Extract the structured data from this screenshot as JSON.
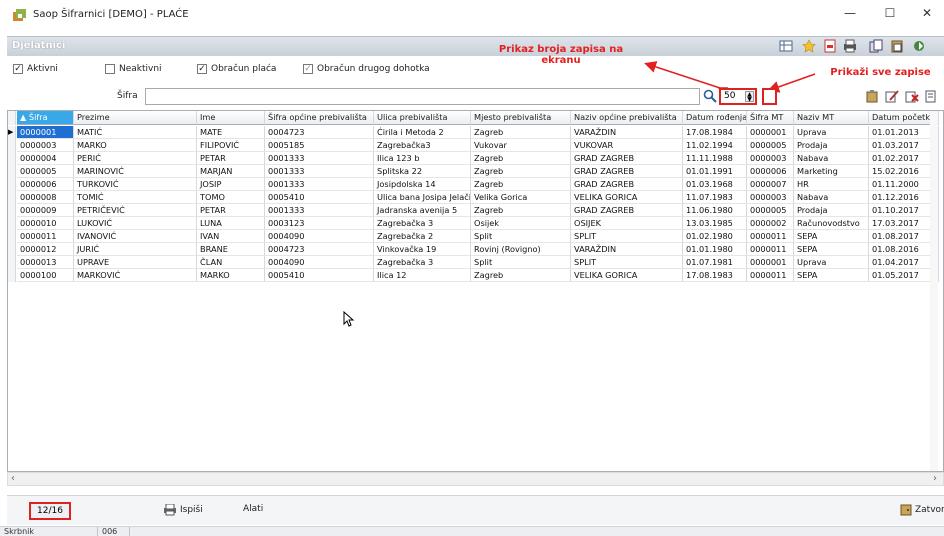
{
  "window": {
    "title": "Saop Šifrarnici [DEMO] - PLAĆE",
    "minimize": "—",
    "maximize": "☐",
    "close": "✕"
  },
  "section": {
    "title": "Djelatnici"
  },
  "filters": [
    {
      "label": "Aktivni",
      "checked": true
    },
    {
      "label": "Neaktivni",
      "checked": false
    },
    {
      "label": "Obračun plaća",
      "checked": true
    },
    {
      "label": "Obračun drugog dohotka",
      "checked": true
    }
  ],
  "annotations": {
    "records_on_screen": "Prikaz broja zapisa na ekranu",
    "show_all": "Prikaži sve zapise"
  },
  "search": {
    "label": "Šifra",
    "value": "",
    "count_value": "50"
  },
  "table": {
    "columns": [
      "Šifra",
      "Prezime",
      "Ime",
      "Šifra općine prebivališta",
      "Ulica prebivališta",
      "Mjesto prebivališta",
      "Naziv općine prebivališta",
      "Datum rođenja",
      "Šifra MT",
      "Naziv MT",
      "Datum početka"
    ],
    "sort_indicator": "▲",
    "rows": [
      [
        "0000001",
        "MATIĆ",
        "MATE",
        "0004723",
        "Ćirila i Metoda 2",
        "Zagreb",
        "VARAŽDIN",
        "17.08.1984",
        "0000001",
        "Uprava",
        "01.01.2013"
      ],
      [
        "0000003",
        "MARKO",
        "FILIPOVIĆ",
        "0005185",
        "Zagrebačka3",
        "Vukovar",
        "VUKOVAR",
        "11.02.1994",
        "0000005",
        "Prodaja",
        "01.03.2017"
      ],
      [
        "0000004",
        "PERIĆ",
        "PETAR",
        "0001333",
        "Ilica 123 b",
        "Zagreb",
        "GRAD ZAGREB",
        "11.11.1988",
        "0000003",
        "Nabava",
        "01.02.2017"
      ],
      [
        "0000005",
        "MARINOVIĆ",
        "MARJAN",
        "0001333",
        "Splitska 22",
        "Zagreb",
        "GRAD ZAGREB",
        "01.01.1991",
        "0000006",
        "Marketing",
        "15.02.2016"
      ],
      [
        "0000006",
        "TURKOVIĆ",
        "JOSIP",
        "0001333",
        "Josipdolska 14",
        "Zagreb",
        "GRAD ZAGREB",
        "01.03.1968",
        "0000007",
        "HR",
        "01.11.2000"
      ],
      [
        "0000008",
        "TOMIĆ",
        "TOMO",
        "0005410",
        "Ulica bana Josipa Jelačića",
        "Velika Gorica",
        "VELIKA GORICA",
        "11.07.1983",
        "0000003",
        "Nabava",
        "01.12.2016"
      ],
      [
        "0000009",
        "PETRIČEVIĆ",
        "PETAR",
        "0001333",
        "Jadranska avenija 5",
        "Zagreb",
        "GRAD ZAGREB",
        "11.06.1980",
        "0000005",
        "Prodaja",
        "01.10.2017"
      ],
      [
        "0000010",
        "LUKOVIĆ",
        "LUNA",
        "0003123",
        "Zagrebačka 3",
        "Osijek",
        "OSIJEK",
        "13.03.1985",
        "0000002",
        "Računovodstvo",
        "17.03.2017"
      ],
      [
        "0000011",
        "IVANOVIĆ",
        "IVAN",
        "0004090",
        "Zagrebačka 2",
        "Split",
        "SPLIT",
        "01.02.1980",
        "0000011",
        "SEPA",
        "01.08.2017"
      ],
      [
        "0000012",
        "JURIĆ",
        "BRANE",
        "0004723",
        "Vinkovačka 19",
        "Rovinj (Rovigno)",
        "VARAŽDIN",
        "01.01.1980",
        "0000011",
        "SEPA",
        "01.08.2016"
      ],
      [
        "0000013",
        "UPRAVE",
        "ČLAN",
        "0004090",
        "Zagrebačka 3",
        "Split",
        "SPLIT",
        "01.07.1981",
        "0000001",
        "Uprava",
        "01.04.2017"
      ],
      [
        "0000100",
        "MARKOVIĆ",
        "MARKO",
        "0005410",
        "Ilica 12",
        "Zagreb",
        "VELIKA GORICA",
        "17.08.1983",
        "0000011",
        "SEPA",
        "01.05.2017"
      ]
    ]
  },
  "bottom": {
    "counter": "12/16",
    "print_label": "Ispiši",
    "tools_label": "Alati",
    "close_label": "Zatvori"
  },
  "status": {
    "user": "Skrbnik",
    "code": "006"
  },
  "colors": {
    "annotation": "#e32020",
    "sorted_header": "#39a8e8",
    "selected_cell": "#1e6fd1"
  }
}
